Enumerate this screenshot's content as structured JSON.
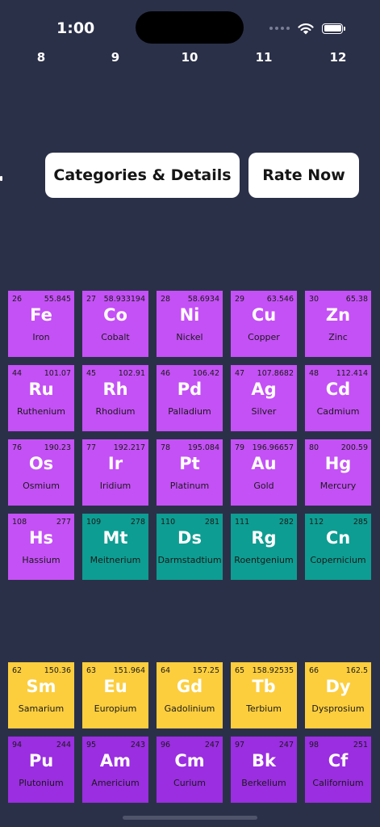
{
  "status_bar": {
    "time": "1:00"
  },
  "group_numbers": [
    "8",
    "9",
    "10",
    "11",
    "12"
  ],
  "buttons": {
    "categories": "Categories & Details",
    "rate": "Rate Now"
  },
  "colors": {
    "background": "#2b3049",
    "transition_metal": "#c451f5",
    "unknown_properties": "#0e9d92",
    "lanthanide": "#fcce3e",
    "actinide": "#9a2ee0"
  },
  "rows": [
    {
      "category": "transition_metal",
      "elements": [
        {
          "number": "26",
          "mass": "55.845",
          "symbol": "Fe",
          "name": "Iron"
        },
        {
          "number": "27",
          "mass": "58.933194",
          "symbol": "Co",
          "name": "Cobalt"
        },
        {
          "number": "28",
          "mass": "58.6934",
          "symbol": "Ni",
          "name": "Nickel"
        },
        {
          "number": "29",
          "mass": "63.546",
          "symbol": "Cu",
          "name": "Copper"
        },
        {
          "number": "30",
          "mass": "65.38",
          "symbol": "Zn",
          "name": "Zinc"
        }
      ]
    },
    {
      "category": "transition_metal",
      "elements": [
        {
          "number": "44",
          "mass": "101.07",
          "symbol": "Ru",
          "name": "Ruthenium"
        },
        {
          "number": "45",
          "mass": "102.91",
          "symbol": "Rh",
          "name": "Rhodium"
        },
        {
          "number": "46",
          "mass": "106.42",
          "symbol": "Pd",
          "name": "Palladium"
        },
        {
          "number": "47",
          "mass": "107.8682",
          "symbol": "Ag",
          "name": "Silver"
        },
        {
          "number": "48",
          "mass": "112.414",
          "symbol": "Cd",
          "name": "Cadmium"
        }
      ]
    },
    {
      "category": "transition_metal",
      "elements": [
        {
          "number": "76",
          "mass": "190.23",
          "symbol": "Os",
          "name": "Osmium"
        },
        {
          "number": "77",
          "mass": "192.217",
          "symbol": "Ir",
          "name": "Iridium"
        },
        {
          "number": "78",
          "mass": "195.084",
          "symbol": "Pt",
          "name": "Platinum"
        },
        {
          "number": "79",
          "mass": "196.96657",
          "symbol": "Au",
          "name": "Gold"
        },
        {
          "number": "80",
          "mass": "200.59",
          "symbol": "Hg",
          "name": "Mercury"
        }
      ]
    },
    {
      "category": "mixed",
      "elements": [
        {
          "number": "108",
          "mass": "277",
          "symbol": "Hs",
          "name": "Hassium",
          "category": "transition_metal"
        },
        {
          "number": "109",
          "mass": "278",
          "symbol": "Mt",
          "name": "Meitnerium",
          "category": "unknown_properties"
        },
        {
          "number": "110",
          "mass": "281",
          "symbol": "Ds",
          "name": "Darmstadtium",
          "category": "unknown_properties"
        },
        {
          "number": "111",
          "mass": "282",
          "symbol": "Rg",
          "name": "Roentgenium",
          "category": "unknown_properties"
        },
        {
          "number": "112",
          "mass": "285",
          "symbol": "Cn",
          "name": "Copernicium",
          "category": "unknown_properties"
        }
      ]
    },
    {
      "category": "lanthanide",
      "elements": [
        {
          "number": "62",
          "mass": "150.36",
          "symbol": "Sm",
          "name": "Samarium"
        },
        {
          "number": "63",
          "mass": "151.964",
          "symbol": "Eu",
          "name": "Europium"
        },
        {
          "number": "64",
          "mass": "157.25",
          "symbol": "Gd",
          "name": "Gadolinium"
        },
        {
          "number": "65",
          "mass": "158.92535",
          "symbol": "Tb",
          "name": "Terbium"
        },
        {
          "number": "66",
          "mass": "162.5",
          "symbol": "Dy",
          "name": "Dysprosium"
        }
      ]
    },
    {
      "category": "actinide",
      "elements": [
        {
          "number": "94",
          "mass": "244",
          "symbol": "Pu",
          "name": "Plutonium"
        },
        {
          "number": "95",
          "mass": "243",
          "symbol": "Am",
          "name": "Americium"
        },
        {
          "number": "96",
          "mass": "247",
          "symbol": "Cm",
          "name": "Curium"
        },
        {
          "number": "97",
          "mass": "247",
          "symbol": "Bk",
          "name": "Berkelium"
        },
        {
          "number": "98",
          "mass": "251",
          "symbol": "Cf",
          "name": "Californium"
        }
      ]
    }
  ]
}
